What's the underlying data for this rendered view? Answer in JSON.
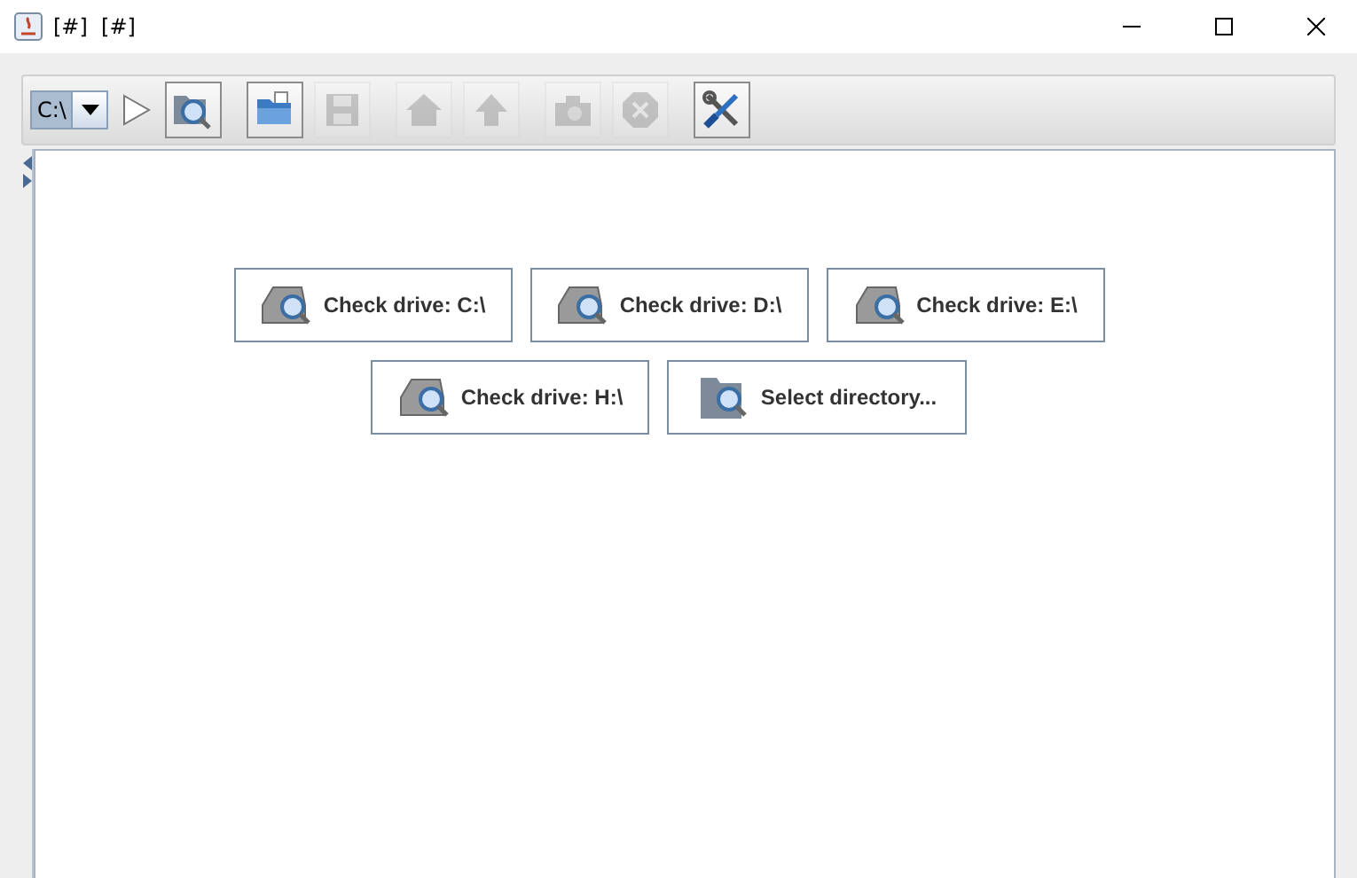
{
  "window": {
    "title": "[#]  [#]"
  },
  "toolbar": {
    "drive": "C:\\",
    "tools": [
      {
        "kind": "go",
        "disabled": false
      },
      {
        "kind": "search-folder",
        "disabled": false
      },
      {
        "kind": "open-folder",
        "disabled": false
      },
      {
        "kind": "save",
        "disabled": true
      },
      {
        "kind": "home",
        "disabled": true
      },
      {
        "kind": "up",
        "disabled": true
      },
      {
        "kind": "camera",
        "disabled": true
      },
      {
        "kind": "stop",
        "disabled": true
      },
      {
        "kind": "tools",
        "disabled": false
      }
    ]
  },
  "actions": [
    {
      "kind": "drive",
      "label": "Check drive: C:\\"
    },
    {
      "kind": "drive",
      "label": "Check drive: D:\\"
    },
    {
      "kind": "drive",
      "label": "Check drive: E:\\"
    },
    {
      "kind": "drive",
      "label": "Check drive: H:\\"
    },
    {
      "kind": "directory",
      "label": "Select directory..."
    }
  ]
}
